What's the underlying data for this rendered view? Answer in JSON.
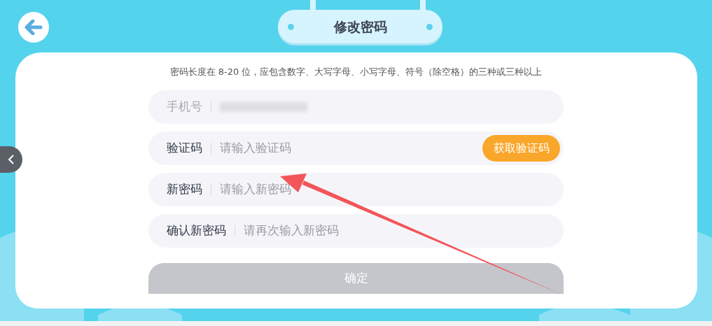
{
  "header": {
    "title": "修改密码"
  },
  "hint": "密码长度在 8-20 位，应包含数字、大写字母、小写字母、符号（除空格）的三种或三种以上",
  "fields": [
    {
      "kind": "phone",
      "label": "手机号",
      "disabled": true
    },
    {
      "kind": "code",
      "label": "验证码",
      "placeholder": "请输入验证码",
      "button": "获取验证码",
      "disabled": false
    },
    {
      "kind": "password",
      "label": "新密码",
      "placeholder": "请输入新密码",
      "disabled": false
    },
    {
      "kind": "password",
      "label": "确认新密码",
      "placeholder": "请再次输入新密码",
      "disabled": false
    }
  ],
  "submit": {
    "label": "确定",
    "disabled": true
  }
}
